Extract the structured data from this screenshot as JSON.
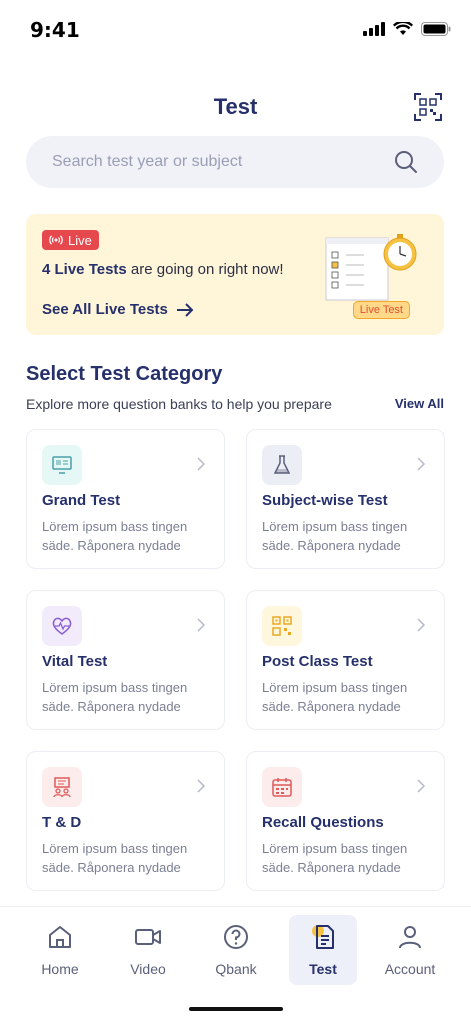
{
  "status": {
    "time": "9:41"
  },
  "header": {
    "title": "Test",
    "qr_icon": "qr-code-icon"
  },
  "search": {
    "placeholder": "Search test year or subject",
    "value": ""
  },
  "live_banner": {
    "badge": "Live",
    "count_text": "4 Live Tests",
    "rest_text": " are going on right now!",
    "cta": "See All Live Tests",
    "illustration_tag": "Live Test",
    "colors": {
      "background": "#fff5d9",
      "badge": "#e5484d"
    }
  },
  "categories_section": {
    "title": "Select Test Category",
    "subtitle": "Explore more question banks to help you prepare",
    "view_all": "View All",
    "cards": [
      {
        "title": "Grand Test",
        "desc": "Lörem ipsum bass tingen säde. Råponera nydade",
        "icon": "monitor-icon",
        "icon_bg": "#e6f8f6"
      },
      {
        "title": "Subject-wise Test",
        "desc": "Lörem ipsum bass tingen säde. Råponera nydade",
        "icon": "flask-icon",
        "icon_bg": "#eceef6"
      },
      {
        "title": "Vital Test",
        "desc": "Lörem ipsum bass tingen säde. Råponera nydade",
        "icon": "heart-pulse-icon",
        "icon_bg": "#f1ebfb"
      },
      {
        "title": "Post Class Test",
        "desc": "Lörem ipsum bass tingen säde. Råponera nydade",
        "icon": "qr-grid-icon",
        "icon_bg": "#fff6de"
      },
      {
        "title": "T & D",
        "desc": "Lörem ipsum bass tingen säde. Råponera nydade",
        "icon": "presentation-icon",
        "icon_bg": "#fdecec"
      },
      {
        "title": "Recall Questions",
        "desc": "Lörem ipsum bass tingen säde. Råponera nydade",
        "icon": "calendar-icon",
        "icon_bg": "#fdecec"
      }
    ]
  },
  "bottom_nav": {
    "items": [
      {
        "label": "Home",
        "icon": "home-icon"
      },
      {
        "label": "Video",
        "icon": "video-icon"
      },
      {
        "label": "Qbank",
        "icon": "question-icon"
      },
      {
        "label": "Test",
        "icon": "test-document-icon",
        "active": true
      },
      {
        "label": "Account",
        "icon": "user-icon"
      }
    ]
  }
}
